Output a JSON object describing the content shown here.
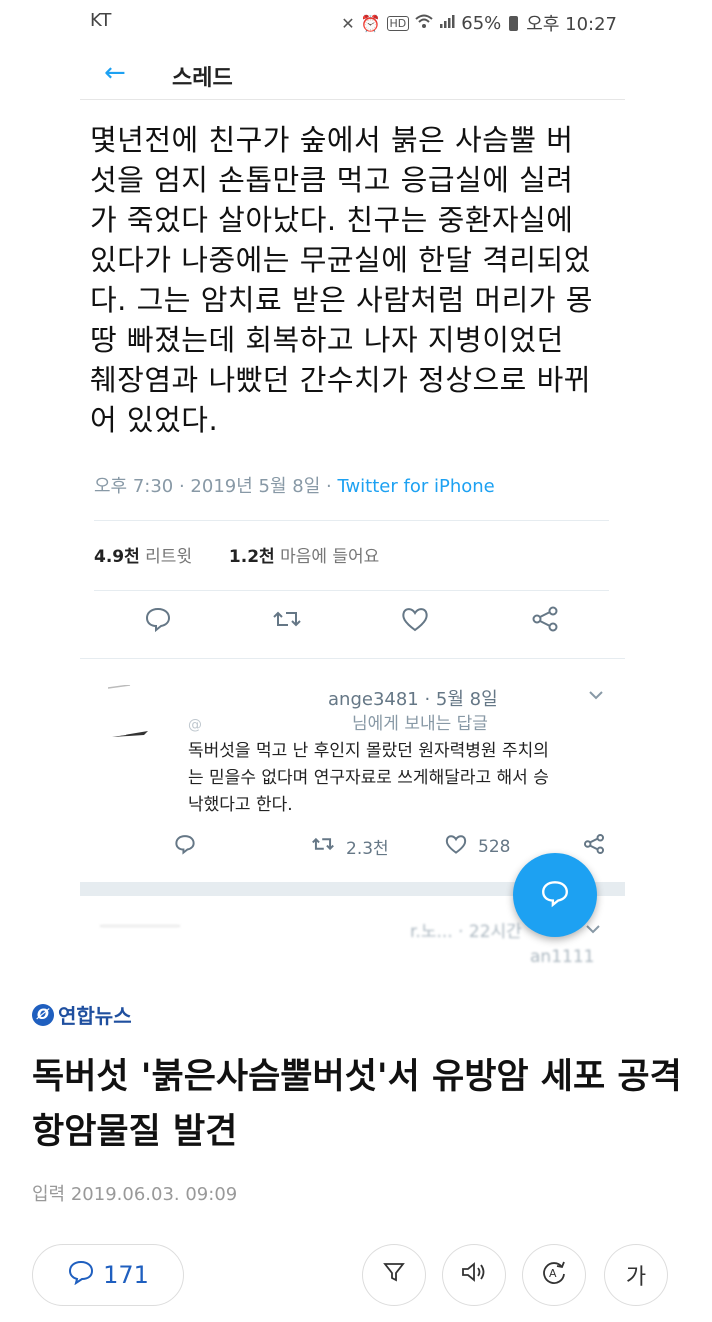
{
  "status_bar": {
    "carrier": "KT",
    "battery": "65%",
    "time": "오후 10:27"
  },
  "topbar": {
    "title": "스레드"
  },
  "tweet": {
    "text": "몇년전에 친구가 숲에서 붉은 사슴뿔 버\n섯을 엄지 손톱만큼 먹고 응급실에 실려\n가 죽었다 살아났다. 친구는 중환자실에\n있다가 나중에는 무균실에 한달 격리되었\n다. 그는 암치료 받은 사람처럼 머리가 몽\n땅 빠졌는데 회복하고 나자 지병이었던\n췌장염과 나빴던 간수치가 정상으로 바뀌\n어 있었다.",
    "timestamp": "오후 7:30 · 2019년 5월 8일 · ",
    "source": "Twitter for iPhone",
    "retweets_count": "4.9천",
    "retweets_label": "리트윗",
    "likes_count": "1.2천",
    "likes_label": "마음에 들어요"
  },
  "reply": {
    "handle": "ange3481 · 5월 8일",
    "to_prefix": "@",
    "to_suffix": "님에게 보내는 답글",
    "text": "독버섯을 먹고 난 후인지 몰랐던 원자력병원 주치의\n는 믿을수 없다며 연구자료로 쓰게해달라고 해서 승\n낙했다고 한다.",
    "retweets": "2.3천",
    "likes": "528"
  },
  "next_reply": {
    "handle_partial": "r.노... · 22시간",
    "id_partial": "an1111"
  },
  "article": {
    "publisher": "연합뉴스",
    "headline": "독버섯 '붉은사슴뿔버섯'서 유방암 세포 공격 항암물질 발견",
    "date": "입력 2019.06.03. 09:09",
    "comments": "171",
    "font_button": "가"
  },
  "colors": {
    "twitter_blue": "#1da1f2",
    "yonhap_blue": "#1f5fbf"
  },
  "icons": [
    "back-arrow-icon",
    "reply-icon",
    "retweet-icon",
    "heart-icon",
    "share-icon",
    "chevron-down-icon",
    "compose-icon",
    "comment-icon",
    "filter-icon",
    "speaker-icon",
    "translate-icon"
  ]
}
